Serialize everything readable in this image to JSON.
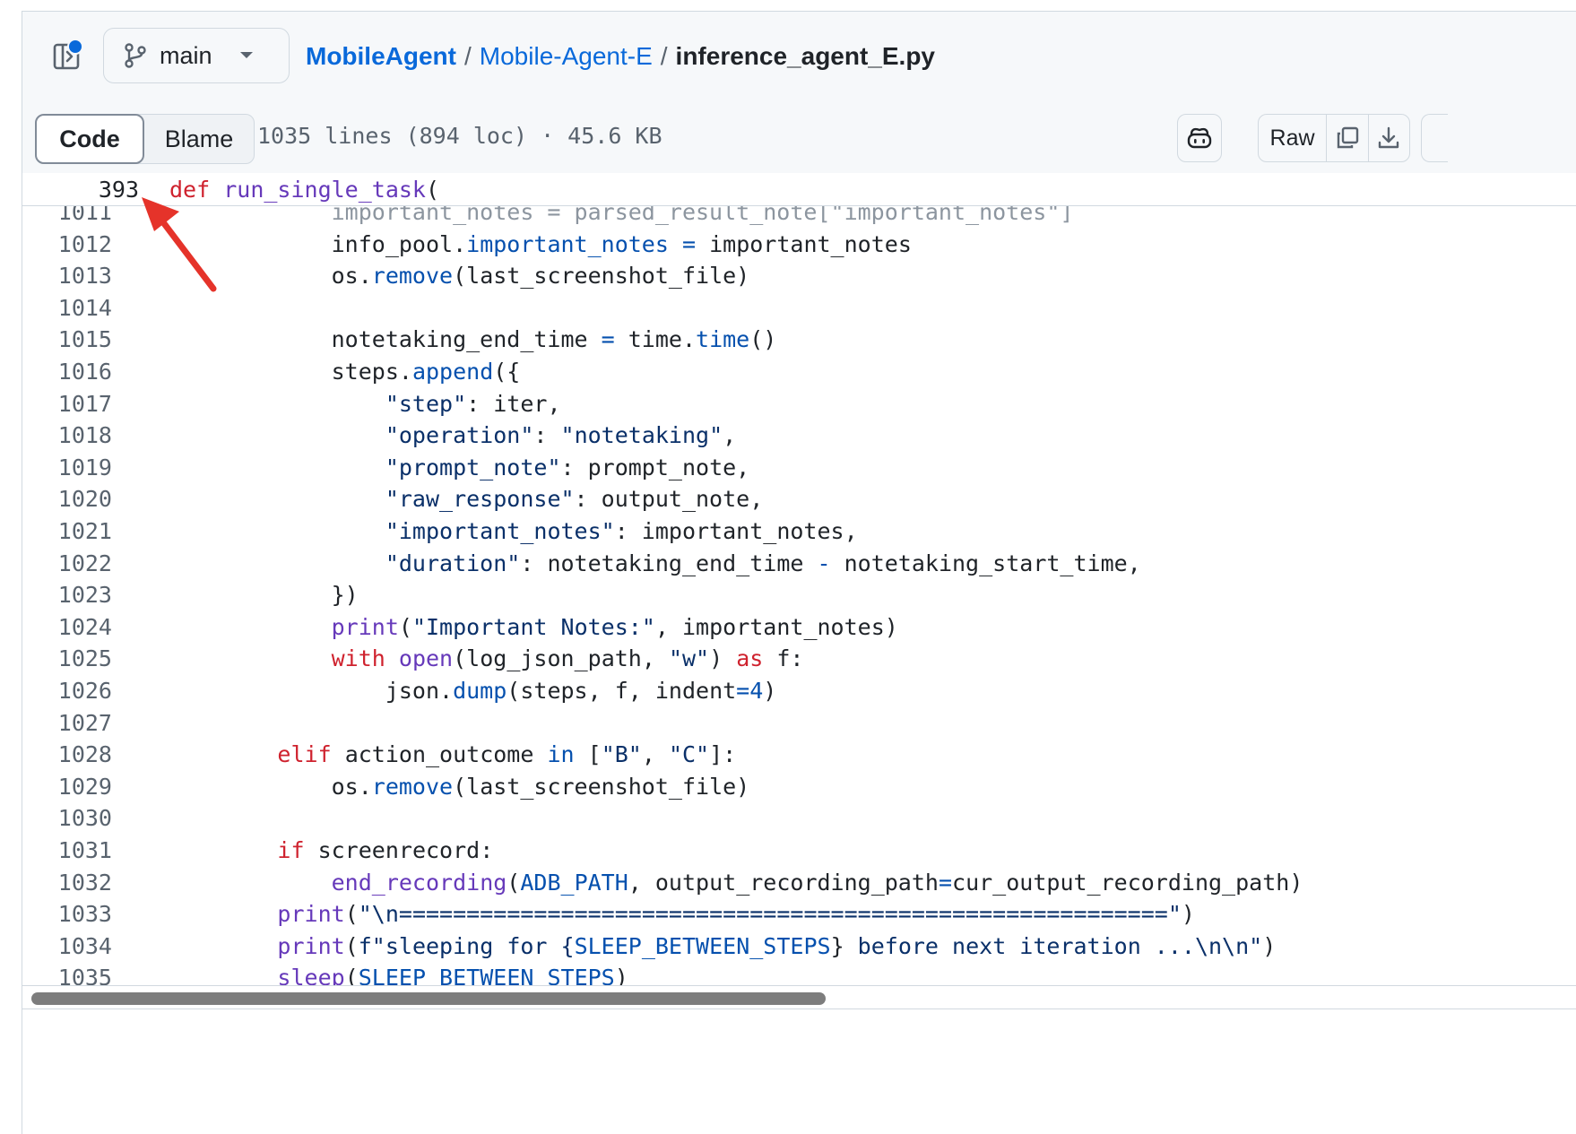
{
  "header": {
    "branch": "main",
    "breadcrumb": {
      "owner": "MobileAgent",
      "sep1": "/",
      "folder": "Mobile-Agent-E",
      "sep2": "/",
      "file": "inference_agent_E.py"
    }
  },
  "toolbar": {
    "code_tab": "Code",
    "blame_tab": "Blame",
    "file_meta": "1035 lines (894 loc) · 45.6 KB",
    "raw_label": "Raw"
  },
  "sticky": {
    "line_number": "393",
    "keyword": "def",
    "func_name": "run_single_task",
    "rest": "("
  },
  "code_lines": [
    {
      "n": "1011",
      "tokens": [
        {
          "t": "            important_notes = parsed_result_note[\"important_notes\"]",
          "c": "partial"
        }
      ]
    },
    {
      "n": "1012",
      "tokens": [
        {
          "t": "            info_pool.",
          "c": ""
        },
        {
          "t": "important_notes",
          "c": "m"
        },
        {
          "t": " ",
          "c": ""
        },
        {
          "t": "=",
          "c": "m"
        },
        {
          "t": " important_notes",
          "c": ""
        }
      ]
    },
    {
      "n": "1013",
      "tokens": [
        {
          "t": "            os.",
          "c": ""
        },
        {
          "t": "remove",
          "c": "m"
        },
        {
          "t": "(last_screenshot_file)",
          "c": ""
        }
      ]
    },
    {
      "n": "1014",
      "tokens": []
    },
    {
      "n": "1015",
      "tokens": [
        {
          "t": "            notetaking_end_time ",
          "c": ""
        },
        {
          "t": "=",
          "c": "m"
        },
        {
          "t": " time.",
          "c": ""
        },
        {
          "t": "time",
          "c": "m"
        },
        {
          "t": "()",
          "c": ""
        }
      ]
    },
    {
      "n": "1016",
      "tokens": [
        {
          "t": "            steps.",
          "c": ""
        },
        {
          "t": "append",
          "c": "m"
        },
        {
          "t": "({",
          "c": ""
        }
      ]
    },
    {
      "n": "1017",
      "tokens": [
        {
          "t": "                ",
          "c": ""
        },
        {
          "t": "\"step\"",
          "c": "s"
        },
        {
          "t": ": iter,",
          "c": ""
        }
      ]
    },
    {
      "n": "1018",
      "tokens": [
        {
          "t": "                ",
          "c": ""
        },
        {
          "t": "\"operation\"",
          "c": "s"
        },
        {
          "t": ": ",
          "c": ""
        },
        {
          "t": "\"notetaking\"",
          "c": "s"
        },
        {
          "t": ",",
          "c": ""
        }
      ]
    },
    {
      "n": "1019",
      "tokens": [
        {
          "t": "                ",
          "c": ""
        },
        {
          "t": "\"prompt_note\"",
          "c": "s"
        },
        {
          "t": ": prompt_note,",
          "c": ""
        }
      ]
    },
    {
      "n": "1020",
      "tokens": [
        {
          "t": "                ",
          "c": ""
        },
        {
          "t": "\"raw_response\"",
          "c": "s"
        },
        {
          "t": ": output_note,",
          "c": ""
        }
      ]
    },
    {
      "n": "1021",
      "tokens": [
        {
          "t": "                ",
          "c": ""
        },
        {
          "t": "\"important_notes\"",
          "c": "s"
        },
        {
          "t": ": important_notes,",
          "c": ""
        }
      ]
    },
    {
      "n": "1022",
      "tokens": [
        {
          "t": "                ",
          "c": ""
        },
        {
          "t": "\"duration\"",
          "c": "s"
        },
        {
          "t": ": notetaking_end_time ",
          "c": ""
        },
        {
          "t": "-",
          "c": "m"
        },
        {
          "t": " notetaking_start_time,",
          "c": ""
        }
      ]
    },
    {
      "n": "1023",
      "tokens": [
        {
          "t": "            })",
          "c": ""
        }
      ]
    },
    {
      "n": "1024",
      "tokens": [
        {
          "t": "            ",
          "c": ""
        },
        {
          "t": "print",
          "c": "f"
        },
        {
          "t": "(",
          "c": ""
        },
        {
          "t": "\"Important Notes:\"",
          "c": "s"
        },
        {
          "t": ", important_notes)",
          "c": ""
        }
      ]
    },
    {
      "n": "1025",
      "tokens": [
        {
          "t": "            ",
          "c": ""
        },
        {
          "t": "with",
          "c": "k"
        },
        {
          "t": " ",
          "c": ""
        },
        {
          "t": "open",
          "c": "f"
        },
        {
          "t": "(log_json_path, ",
          "c": ""
        },
        {
          "t": "\"w\"",
          "c": "s"
        },
        {
          "t": ") ",
          "c": ""
        },
        {
          "t": "as",
          "c": "k"
        },
        {
          "t": " f:",
          "c": ""
        }
      ]
    },
    {
      "n": "1026",
      "tokens": [
        {
          "t": "                json.",
          "c": ""
        },
        {
          "t": "dump",
          "c": "m"
        },
        {
          "t": "(steps, f, indent",
          "c": ""
        },
        {
          "t": "=",
          "c": "m"
        },
        {
          "t": "4",
          "c": "m"
        },
        {
          "t": ")",
          "c": ""
        }
      ]
    },
    {
      "n": "1027",
      "tokens": []
    },
    {
      "n": "1028",
      "tokens": [
        {
          "t": "        ",
          "c": ""
        },
        {
          "t": "elif",
          "c": "k"
        },
        {
          "t": " action_outcome ",
          "c": ""
        },
        {
          "t": "in",
          "c": "m"
        },
        {
          "t": " [",
          "c": ""
        },
        {
          "t": "\"B\"",
          "c": "s"
        },
        {
          "t": ", ",
          "c": ""
        },
        {
          "t": "\"C\"",
          "c": "s"
        },
        {
          "t": "]:",
          "c": ""
        }
      ]
    },
    {
      "n": "1029",
      "tokens": [
        {
          "t": "            os.",
          "c": ""
        },
        {
          "t": "remove",
          "c": "m"
        },
        {
          "t": "(last_screenshot_file)",
          "c": ""
        }
      ]
    },
    {
      "n": "1030",
      "tokens": []
    },
    {
      "n": "1031",
      "tokens": [
        {
          "t": "        ",
          "c": ""
        },
        {
          "t": "if",
          "c": "k"
        },
        {
          "t": " screenrecord:",
          "c": ""
        }
      ]
    },
    {
      "n": "1032",
      "tokens": [
        {
          "t": "            ",
          "c": ""
        },
        {
          "t": "end_recording",
          "c": "f"
        },
        {
          "t": "(",
          "c": ""
        },
        {
          "t": "ADB_PATH",
          "c": "m"
        },
        {
          "t": ", output_recording_path",
          "c": ""
        },
        {
          "t": "=",
          "c": "m"
        },
        {
          "t": "cur_output_recording_path)",
          "c": ""
        }
      ]
    },
    {
      "n": "1033",
      "tokens": [
        {
          "t": "        ",
          "c": ""
        },
        {
          "t": "print",
          "c": "f"
        },
        {
          "t": "(",
          "c": ""
        },
        {
          "t": "\"\\n=========================================================\"",
          "c": "s"
        },
        {
          "t": ")",
          "c": ""
        }
      ]
    },
    {
      "n": "1034",
      "tokens": [
        {
          "t": "        ",
          "c": ""
        },
        {
          "t": "print",
          "c": "f"
        },
        {
          "t": "(",
          "c": ""
        },
        {
          "t": "f\"sleeping for {",
          "c": "s"
        },
        {
          "t": "SLEEP_BETWEEN_STEPS",
          "c": "m"
        },
        {
          "t": "}",
          "c": ""
        },
        {
          "t": " before next iteration ...\\n\\n\"",
          "c": "s"
        },
        {
          "t": ")",
          "c": ""
        }
      ]
    },
    {
      "n": "1035",
      "tokens": [
        {
          "t": "        ",
          "c": ""
        },
        {
          "t": "sleep",
          "c": "f"
        },
        {
          "t": "(",
          "c": ""
        },
        {
          "t": "SLEEP_BETWEEN_STEPS",
          "c": "m"
        },
        {
          "t": ")",
          "c": ""
        }
      ]
    }
  ],
  "icons": {
    "tree_toggle": "sidebar-expand-icon",
    "branch": "git-branch-icon",
    "copilot": "copilot-icon",
    "copy": "copy-icon",
    "download": "download-icon"
  },
  "colors": {
    "link": "#0969da",
    "keyword": "#cf222e",
    "function": "#6639ba",
    "constant": "#0550ae",
    "string": "#0a3069",
    "annotation_arrow": "#e5332a"
  }
}
